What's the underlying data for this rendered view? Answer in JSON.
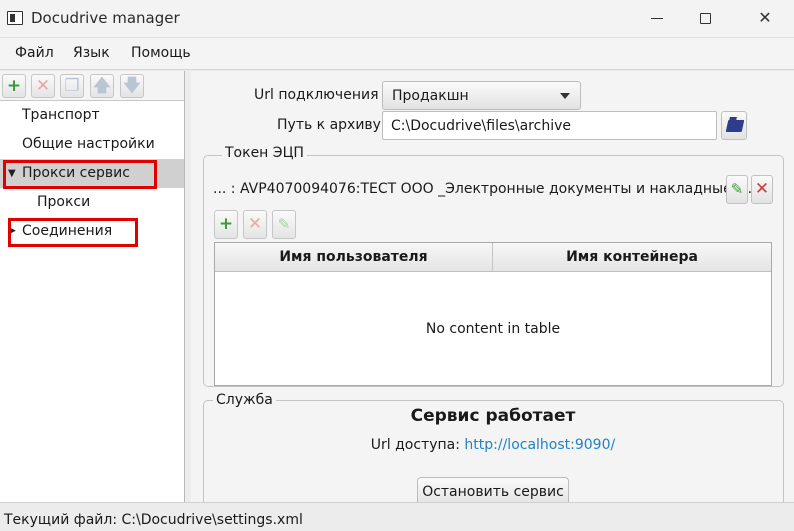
{
  "window": {
    "title": "Docudrive manager",
    "icon": "app-window-icon"
  },
  "menu": {
    "items": [
      "Файл",
      "Язык",
      "Помощь"
    ]
  },
  "toolbar": {
    "add": "+",
    "remove": "✕",
    "copy": "❐",
    "up": "🡅",
    "down": "🡇"
  },
  "tree": {
    "items": [
      {
        "label": "Транспорт"
      },
      {
        "label": "Общие настройки"
      },
      {
        "label": "Прокси сервис"
      },
      {
        "label": "Прокси"
      },
      {
        "label": "Соединения"
      }
    ],
    "selected": "Прокси сервис"
  },
  "connection": {
    "url_label": "Url подключения",
    "url_value": "Продакшн",
    "path_label": "Путь к архиву",
    "path_value": "C:\\Docudrive\\files\\archive"
  },
  "token": {
    "group_title": "Токен ЭЦП",
    "value": "... :  AVP4070094076:ТЕСТ ООО _Электронные документы и накладные_ ...",
    "edit_icon": "✎",
    "delete_icon": "✕"
  },
  "users": {
    "add": "+",
    "remove": "✕",
    "edit": "✎",
    "columns": [
      "Имя пользователя",
      "Имя контейнера"
    ],
    "rows": [],
    "empty_message": "No content in table"
  },
  "service": {
    "group_title": "Служба",
    "status": "Сервис работает",
    "url_label": "Url доступа:",
    "url": "http://localhost:9090/",
    "stop_button": "Остановить сервис"
  },
  "status_bar": {
    "text": "Текущий файл: C:\\Docudrive\\settings.xml"
  },
  "colors": {
    "highlight_box": "#e00000",
    "link": "#1f83c4",
    "add_green": "#3c9a3c"
  }
}
